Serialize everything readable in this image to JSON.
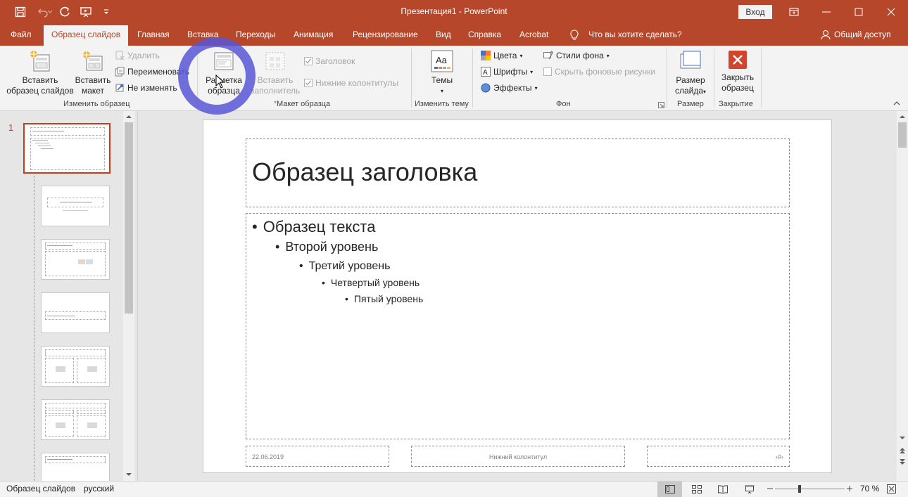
{
  "window": {
    "title": "Презентация1  -  PowerPoint",
    "login_label": "Вход",
    "accent": "#b7472a",
    "highlight": "#5856d6"
  },
  "tabs": [
    {
      "label": "Файл"
    },
    {
      "label": "Образец слайдов",
      "active": true
    },
    {
      "label": "Главная"
    },
    {
      "label": "Вставка"
    },
    {
      "label": "Переходы"
    },
    {
      "label": "Анимация"
    },
    {
      "label": "Рецензирование"
    },
    {
      "label": "Вид"
    },
    {
      "label": "Справка"
    },
    {
      "label": "Acrobat"
    }
  ],
  "tell_me": "Что вы хотите сделать?",
  "share": "Общий доступ",
  "ribbon": {
    "edit_master": {
      "group_label": "Изменить образец",
      "insert_master_l1": "Вставить",
      "insert_master_l2": "образец слайдов",
      "insert_layout_l1": "Вставить",
      "insert_layout_l2": "макет",
      "delete": "Удалить",
      "rename": "Переименовать",
      "preserve": "Не изменять"
    },
    "master_layout": {
      "group_label": "Макет образца",
      "master_layout_l1": "Разметка",
      "master_layout_l2": "образца",
      "insert_ph_l1": "Вставить",
      "insert_ph_l2": "заполнитель",
      "title_chk": "Заголовок",
      "footers_chk": "Нижние колонтитулы"
    },
    "edit_theme": {
      "group_label": "Изменить тему",
      "themes": "Темы"
    },
    "background": {
      "group_label": "Фон",
      "colors": "Цвета",
      "fonts": "Шрифты",
      "effects": "Эффекты",
      "bg_styles": "Стили фона",
      "hide_bg": "Скрыть фоновые рисунки"
    },
    "size": {
      "group_label": "Размер",
      "slide_size_l1": "Размер",
      "slide_size_l2": "слайда"
    },
    "close": {
      "group_label": "Закрытие",
      "close_l1": "Закрыть",
      "close_l2": "образец"
    }
  },
  "thumbnails": {
    "master_number": "1"
  },
  "slide": {
    "title": "Образец заголовка",
    "levels": [
      "Образец текста",
      "Второй уровень",
      "Третий уровень",
      "Четвертый уровень",
      "Пятый уровень"
    ],
    "footer_date": "22.06.2019",
    "footer_text": "Нижний колонтитул",
    "footer_num": "‹#›"
  },
  "status": {
    "view_name": "Образец слайдов",
    "language": "русский",
    "zoom": "70 %",
    "zoom_fraction": 0.35
  }
}
